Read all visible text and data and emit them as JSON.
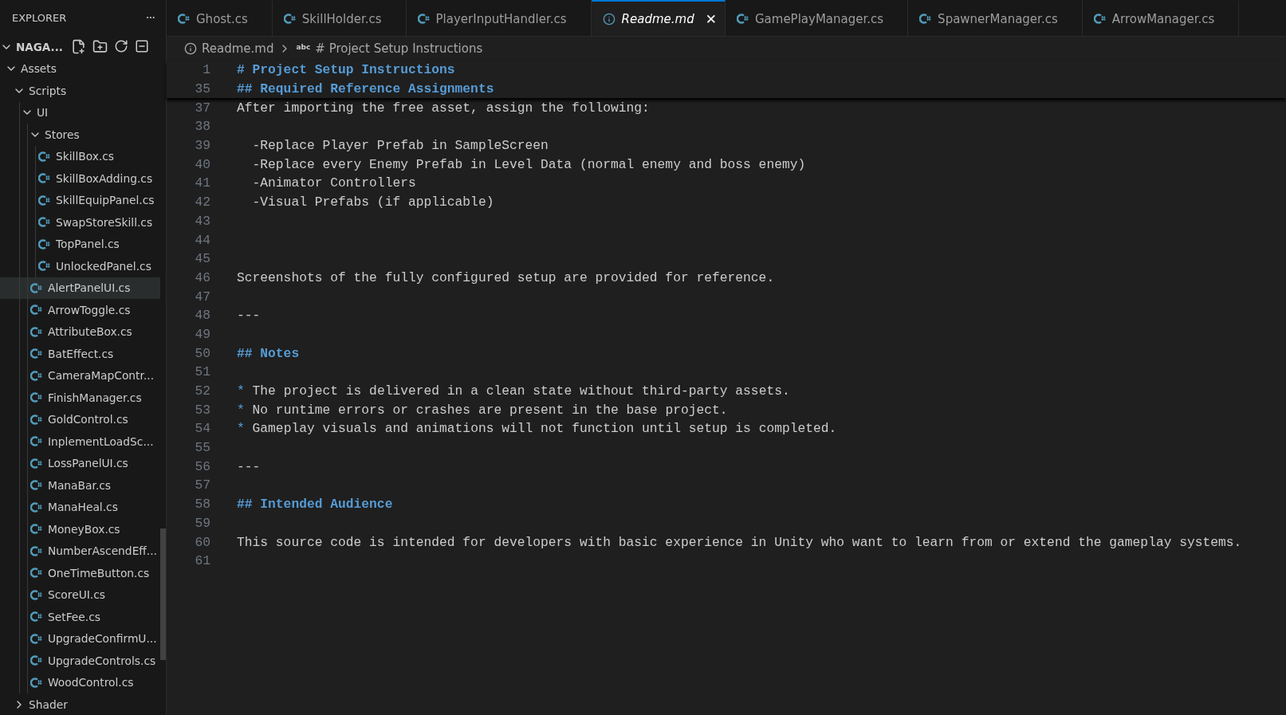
{
  "sidebar": {
    "title": "EXPLORER",
    "more": "···",
    "root": {
      "label": "NAGA...",
      "expanded": true
    },
    "tree": [
      {
        "label": "Assets",
        "kind": "folder",
        "expanded": true,
        "selected": false,
        "children": [
          {
            "label": "Scripts",
            "kind": "folder",
            "expanded": true,
            "selected": false,
            "children": [
              {
                "label": "UI",
                "kind": "folder",
                "expanded": true,
                "selected": false,
                "children": [
                  {
                    "label": "Stores",
                    "kind": "folder",
                    "expanded": true,
                    "selected": false,
                    "children": [
                      {
                        "label": "SkillBox.cs",
                        "kind": "file",
                        "selected": false
                      },
                      {
                        "label": "SkillBoxAdding.cs",
                        "kind": "file",
                        "selected": false
                      },
                      {
                        "label": "SkillEquipPanel.cs",
                        "kind": "file",
                        "selected": false
                      },
                      {
                        "label": "SwapStoreSkill.cs",
                        "kind": "file",
                        "selected": false
                      },
                      {
                        "label": "TopPanel.cs",
                        "kind": "file",
                        "selected": false
                      },
                      {
                        "label": "UnlockedPanel.cs",
                        "kind": "file",
                        "selected": false
                      }
                    ]
                  },
                  {
                    "label": "AlertPanelUI.cs",
                    "kind": "file",
                    "selected": true
                  },
                  {
                    "label": "ArrowToggle.cs",
                    "kind": "file",
                    "selected": false
                  },
                  {
                    "label": "AttributeBox.cs",
                    "kind": "file",
                    "selected": false
                  },
                  {
                    "label": "BatEffect.cs",
                    "kind": "file",
                    "selected": false
                  },
                  {
                    "label": "CameraMapContr...",
                    "kind": "file",
                    "selected": false
                  },
                  {
                    "label": "FinishManager.cs",
                    "kind": "file",
                    "selected": false
                  },
                  {
                    "label": "GoldControl.cs",
                    "kind": "file",
                    "selected": false
                  },
                  {
                    "label": "InplementLoadSc...",
                    "kind": "file",
                    "selected": false
                  },
                  {
                    "label": "LossPanelUI.cs",
                    "kind": "file",
                    "selected": false
                  },
                  {
                    "label": "ManaBar.cs",
                    "kind": "file",
                    "selected": false
                  },
                  {
                    "label": "ManaHeal.cs",
                    "kind": "file",
                    "selected": false
                  },
                  {
                    "label": "MoneyBox.cs",
                    "kind": "file",
                    "selected": false
                  },
                  {
                    "label": "NumberAscendEff...",
                    "kind": "file",
                    "selected": false
                  },
                  {
                    "label": "OneTimeButton.cs",
                    "kind": "file",
                    "selected": false
                  },
                  {
                    "label": "ScoreUI.cs",
                    "kind": "file",
                    "selected": false
                  },
                  {
                    "label": "SetFee.cs",
                    "kind": "file",
                    "selected": false
                  },
                  {
                    "label": "UpgradeConfirmU...",
                    "kind": "file",
                    "selected": false
                  },
                  {
                    "label": "UpgradeControls.cs",
                    "kind": "file",
                    "selected": false
                  },
                  {
                    "label": "WoodControl.cs",
                    "kind": "file",
                    "selected": false
                  }
                ]
              }
            ]
          },
          {
            "label": "Shader",
            "kind": "folder",
            "expanded": false,
            "selected": false
          }
        ]
      }
    ]
  },
  "tabs": [
    {
      "label": "Ghost.cs",
      "kind": "csharp",
      "selected": false
    },
    {
      "label": "SkillHolder.cs",
      "kind": "csharp",
      "selected": false
    },
    {
      "label": "PlayerInputHandler.cs",
      "kind": "csharp",
      "selected": false
    },
    {
      "label": "Readme.md",
      "kind": "markdown",
      "selected": true,
      "close": "✕"
    },
    {
      "label": "GamePlayManager.cs",
      "kind": "csharp",
      "selected": false
    },
    {
      "label": "SpawnerManager.cs",
      "kind": "csharp",
      "selected": false
    },
    {
      "label": "ArrowManager.cs",
      "kind": "csharp",
      "selected": false
    }
  ],
  "breadcrumb": {
    "file": "Readme.md",
    "symbol_icon": "abc",
    "symbol": "# Project Setup Instructions"
  },
  "sticky_lines": [
    {
      "number": "1",
      "kind": "heading",
      "text": "# Project Setup Instructions"
    },
    {
      "number": "35",
      "kind": "heading",
      "text": "## Required Reference Assignments"
    }
  ],
  "lines": [
    {
      "number": "37",
      "kind": "plain",
      "text": "After importing the free asset, assign the following:"
    },
    {
      "number": "38",
      "kind": "plain"
    },
    {
      "number": "39",
      "kind": "plain",
      "text": "  -Replace Player Prefab in SampleScreen"
    },
    {
      "number": "40",
      "kind": "plain",
      "text": "  -Replace every Enemy Prefab in Level Data (normal enemy and boss enemy)"
    },
    {
      "number": "41",
      "kind": "plain",
      "text": "  -Animator Controllers"
    },
    {
      "number": "42",
      "kind": "plain",
      "text": "  -Visual Prefabs (if applicable)"
    },
    {
      "number": "43",
      "kind": "plain"
    },
    {
      "number": "44",
      "kind": "plain"
    },
    {
      "number": "45",
      "kind": "plain"
    },
    {
      "number": "46",
      "kind": "plain",
      "text": "Screenshots of the fully configured setup are provided for reference."
    },
    {
      "number": "47",
      "kind": "plain"
    },
    {
      "number": "48",
      "kind": "plain",
      "text": "---"
    },
    {
      "number": "49",
      "kind": "plain"
    },
    {
      "number": "50",
      "kind": "heading",
      "text": "## Notes"
    },
    {
      "number": "51",
      "kind": "plain"
    },
    {
      "number": "52",
      "kind": "bullet",
      "marker": "*",
      "text": "The project is delivered in a clean state without third-party assets."
    },
    {
      "number": "53",
      "kind": "bullet",
      "marker": "*",
      "text": "No runtime errors or crashes are present in the base project."
    },
    {
      "number": "54",
      "kind": "bullet",
      "marker": "*",
      "text": "Gameplay visuals and animations will not function until setup is completed."
    },
    {
      "number": "55",
      "kind": "plain"
    },
    {
      "number": "56",
      "kind": "plain",
      "text": "---"
    },
    {
      "number": "57",
      "kind": "plain"
    },
    {
      "number": "58",
      "kind": "heading",
      "text": "## Intended Audience"
    },
    {
      "number": "59",
      "kind": "plain"
    },
    {
      "number": "60",
      "kind": "plain",
      "text": "This source code is intended for developers with basic experience in Unity who want to learn from or extend the gameplay systems."
    },
    {
      "number": "61",
      "kind": "plain"
    }
  ]
}
